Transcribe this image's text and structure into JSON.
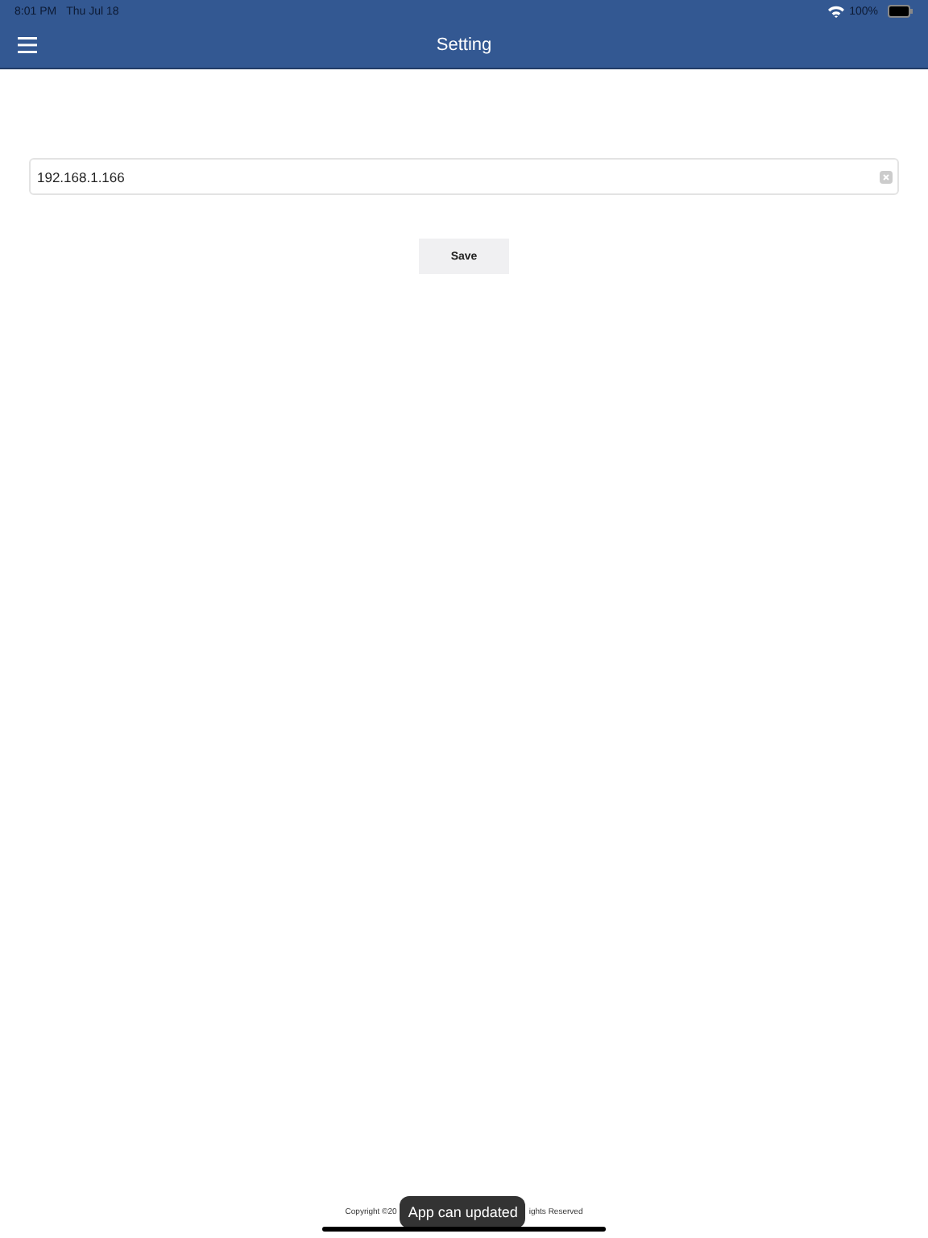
{
  "status_bar": {
    "time": "8:01 PM",
    "date": "Thu Jul 18",
    "battery": "100%"
  },
  "nav_bar": {
    "title": "Setting"
  },
  "server_field": {
    "value": "192.168.1.166"
  },
  "save_button": {
    "label": "Save"
  },
  "footer": {
    "copyright_left": "Copyright ©20",
    "copyright_right": "ights Reserved"
  },
  "toast": {
    "message": "App can updated"
  }
}
